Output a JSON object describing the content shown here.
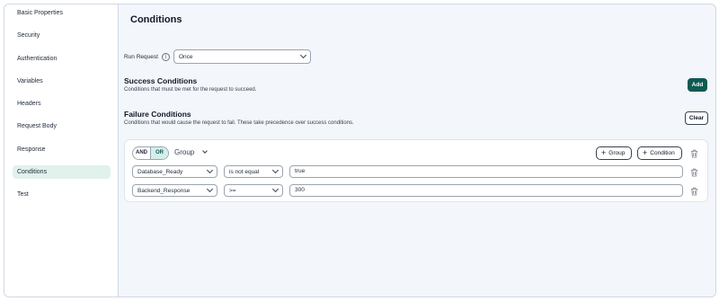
{
  "sidebar": {
    "items": [
      {
        "label": "Basic Properties"
      },
      {
        "label": "Security"
      },
      {
        "label": "Authentication"
      },
      {
        "label": "Variables"
      },
      {
        "label": "Headers"
      },
      {
        "label": "Request Body"
      },
      {
        "label": "Response"
      },
      {
        "label": "Conditions",
        "active": true
      },
      {
        "label": "Test"
      }
    ]
  },
  "main": {
    "title": "Conditions",
    "run_request": {
      "label": "Run Request",
      "value": "Once"
    },
    "success": {
      "title": "Success Conditions",
      "description": "Conditions that must be met for the request to succeed.",
      "add_label": "Add"
    },
    "failure": {
      "title": "Failure Conditions",
      "description": "Conditions that would cause the request to fail. These take precedence over success conditions.",
      "clear_label": "Clear"
    },
    "group": {
      "and_label": "AND",
      "or_label": "OR",
      "selected_operator": "OR",
      "label": "Group",
      "add_group_label": "Group",
      "add_condition_label": "Condition",
      "conditions": [
        {
          "field": "Database_Ready",
          "operator": "is not equal",
          "value": "true"
        },
        {
          "field": "Backend_Response",
          "operator": ">=",
          "value": "300"
        }
      ]
    }
  },
  "colors": {
    "accent": "#0f5a53",
    "active_nav": "#e1f1ec",
    "main_bg": "#f3f6fa"
  }
}
